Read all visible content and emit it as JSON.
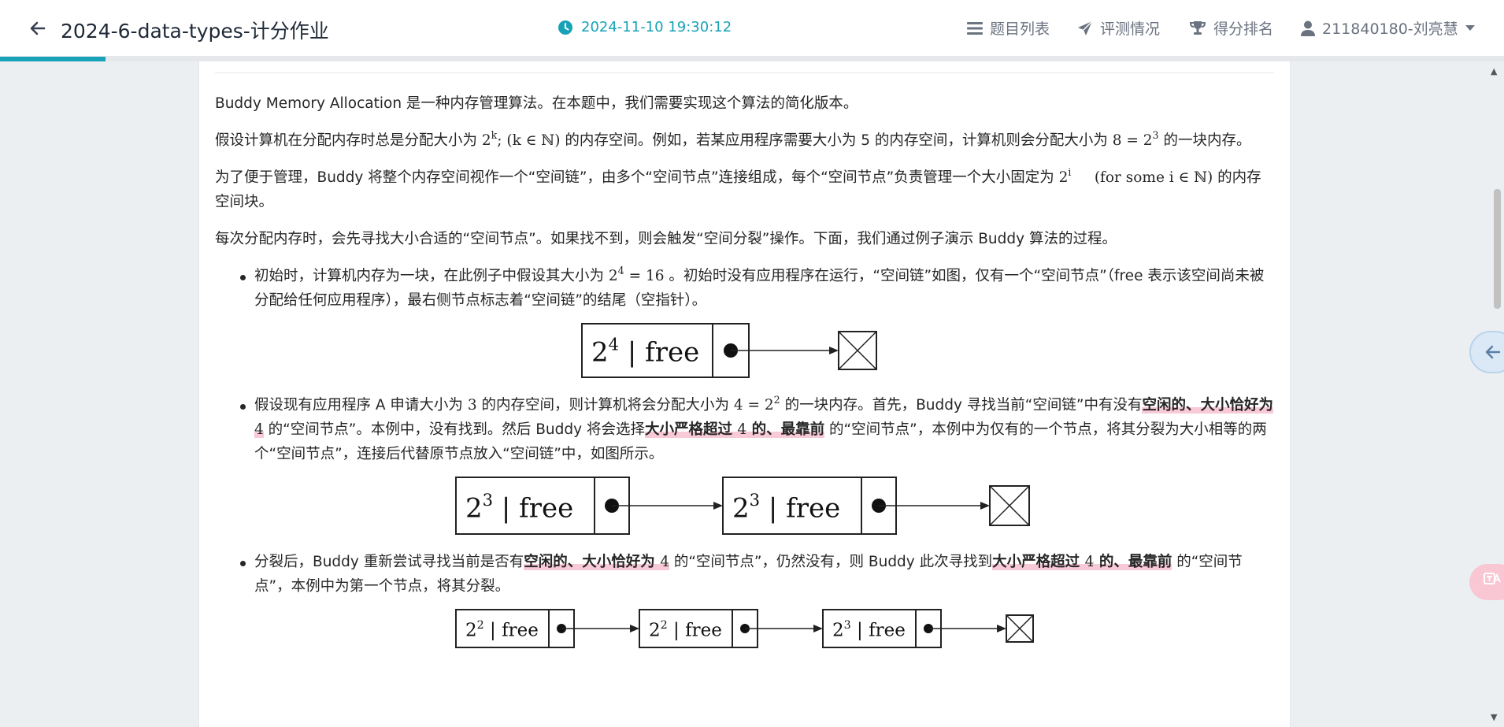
{
  "header": {
    "title": "2024-6-data-types-计分作业",
    "timestamp": "2024-11-10 19:30:12",
    "nav": [
      {
        "label": "题目列表",
        "icon": "list-icon"
      },
      {
        "label": "评测情况",
        "icon": "paper-plane-icon"
      },
      {
        "label": "得分排名",
        "icon": "trophy-icon"
      },
      {
        "label": "211840180-刘亮慧",
        "icon": "user-icon"
      }
    ],
    "progress": 0.07,
    "accent": "#17a2b8"
  },
  "content": {
    "p1": "Buddy Memory Allocation 是一种内存管理算法。在本题中，我们需要实现这个算法的简化版本。",
    "p2_a": "假设计算机在分配内存时总是分配大小为 ",
    "p2_b": " 的内存空间。例如，若某应用程序需要大小为 5 的内存空间，计算机则会分配大小为 ",
    "p2_c": " 的一块内存。",
    "p3_a": "为了便于管理，Buddy 将整个内存空间视作一个“空间链”，由多个“空间节点”连接组成，每个“空间节点”负责管理一个大小固定为 ",
    "p3_b": " 的内存空间块。",
    "p4": "每次分配内存时，会先寻找大小合适的“空间节点”。如果找不到，则会触发“空间分裂”操作。下面，我们通过例子演示 Buddy 算法的过程。",
    "b1_a": "初始时，计算机内存为一块，在此例子中假设其大小为 ",
    "b1_b": " 。初始时没有应用程序在运行，“空间链”如图，仅有一个“空间节点”（free 表示该空间尚未被分配给任何应用程序），最右侧节点标志着“空间链”的结尾（空指针）。",
    "b2_a": "假设现有应用程序 A 申请大小为 ",
    "b2_b": " 的内存空间，则计算机将会分配大小为 ",
    "b2_c": " 的一块内存。首先，Buddy 寻找当前“空间链”中有没有",
    "b2_hl1": "空闲的、大小恰好为 ",
    "b2_d": " 的“空间节点”。本例中，没有找到。然后 Buddy 将会选择",
    "b2_hl2": "大小严格超过 ",
    "b2_hl2b": " 的、最靠前",
    "b2_e": " 的“空间节点”，本例中为仅有的一个节点，将其分裂为大小相等的两个“空间节点”，连接后代替原节点放入“空间链”中，如图所示。",
    "b3_a": "分裂后，Buddy 重新尝试寻找当前是否有",
    "b3_hl1": "空闲的、大小恰好为 ",
    "b3_b": " 的“空间节点”，仍然没有，则 Buddy 此次寻找到",
    "b3_hl2": "大小严格超过 ",
    "b3_hl2b": " 的、最靠前",
    "b3_c": " 的“空间节点”，本例中为第一个节点，将其分裂。"
  },
  "math": {
    "base": "2",
    "k": "k",
    "semi": ";",
    "k_in_N": "(k ∈ ℕ)",
    "eight": "8 = 2",
    "three": "3",
    "i": "i",
    "for_some": "(for some i ∈ ℕ)",
    "sixteen_a": "2",
    "four": "4",
    "sixteen_b": " = 16",
    "n3": "3",
    "four_eq": "4 = 2",
    "two": "2",
    "n4": "4"
  },
  "diagrams": {
    "free_label": "free",
    "fig1": [
      "4"
    ],
    "fig2": [
      "3",
      "3"
    ],
    "fig3": [
      "2",
      "2",
      "3"
    ]
  }
}
